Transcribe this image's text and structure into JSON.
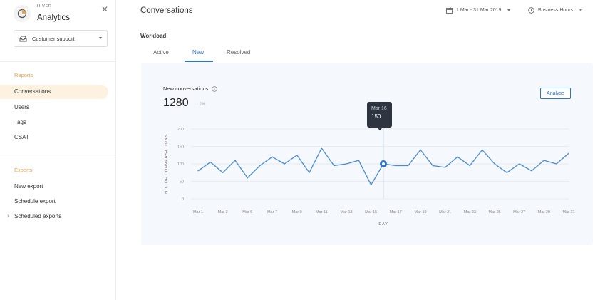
{
  "brand": {
    "small": "HIVER",
    "name": "Analytics"
  },
  "sidebar": {
    "inbox_select": "Customer support",
    "reports_label": "Reports",
    "reports_items": [
      {
        "label": "Conversations",
        "active": true
      },
      {
        "label": "Users"
      },
      {
        "label": "Tags"
      },
      {
        "label": "CSAT"
      }
    ],
    "exports_label": "Exports",
    "exports_items": [
      {
        "label": "New export"
      },
      {
        "label": "Schedule export"
      },
      {
        "label": "Scheduled exports"
      }
    ]
  },
  "header": {
    "title": "Conversations",
    "date_range": "1 Mar - 31 Mar 2019",
    "hours": "Business Hours"
  },
  "workload": {
    "label": "Workload",
    "tabs": [
      {
        "label": "Active"
      },
      {
        "label": "New",
        "active": true
      },
      {
        "label": "Resolved"
      }
    ]
  },
  "metric": {
    "title": "New conversations",
    "value": "1280",
    "change": "↑ 2%",
    "analyse_label": "Analyse"
  },
  "tooltip": {
    "date": "Mar 16",
    "value": "150"
  },
  "colors": {
    "accent": "#2f74c7",
    "section": "#e0a45a",
    "active_bg": "#fdf1e0"
  },
  "chart_data": {
    "type": "line",
    "xlabel": "DAY",
    "ylabel": "NO. OF CONVERSATIONS",
    "ylim": [
      0,
      200
    ],
    "yticks": [
      0,
      50,
      100,
      150,
      200
    ],
    "xtick_labels": [
      "Mar 1",
      "Mar 3",
      "Mar 5",
      "Mar 7",
      "Mar 9",
      "Mar 11",
      "Mar 13",
      "Mar 15",
      "Mar 17",
      "Mar 19",
      "Mar 21",
      "Mar 23",
      "Mar 25",
      "Mar 27",
      "Mar 29",
      "Mar 31"
    ],
    "x": [
      "Mar 1",
      "Mar 2",
      "Mar 3",
      "Mar 4",
      "Mar 5",
      "Mar 6",
      "Mar 7",
      "Mar 8",
      "Mar 9",
      "Mar 10",
      "Mar 11",
      "Mar 12",
      "Mar 13",
      "Mar 14",
      "Mar 15",
      "Mar 16",
      "Mar 17",
      "Mar 18",
      "Mar 19",
      "Mar 20",
      "Mar 21",
      "Mar 22",
      "Mar 23",
      "Mar 24",
      "Mar 25",
      "Mar 26",
      "Mar 27",
      "Mar 28",
      "Mar 29",
      "Mar 30",
      "Mar 31"
    ],
    "series": [
      {
        "values": [
          80,
          105,
          75,
          110,
          60,
          95,
          120,
          100,
          125,
          75,
          145,
          95,
          100,
          110,
          40,
          100,
          95,
          95,
          140,
          95,
          90,
          120,
          95,
          140,
          100,
          75,
          100,
          80,
          110,
          100,
          130
        ]
      }
    ],
    "highlight_index": 15,
    "grid": true
  }
}
